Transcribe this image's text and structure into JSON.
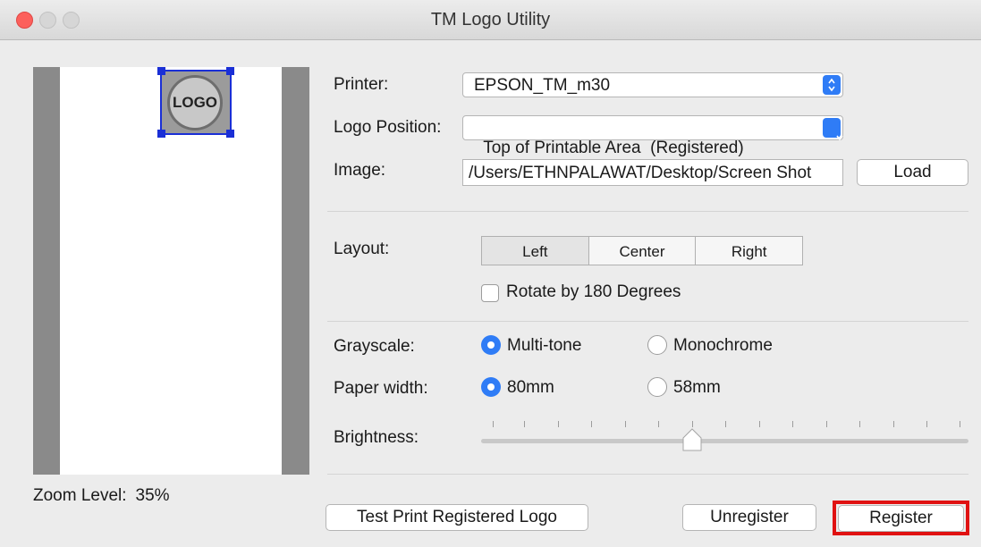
{
  "window": {
    "title": "TM Logo Utility"
  },
  "preview": {
    "logo_text": "LOGO",
    "zoom_label": "Zoom Level:",
    "zoom_value": "35%"
  },
  "printer": {
    "label": "Printer:",
    "value": "EPSON_TM_m30"
  },
  "logo_position": {
    "label": "Logo Position:",
    "value": "Top of Printable Area  (Registered)"
  },
  "image": {
    "label": "Image:",
    "path": "/Users/ETHNPALAWAT/Desktop/Screen Shot",
    "load_label": "Load"
  },
  "layout": {
    "label": "Layout:",
    "options": [
      "Left",
      "Center",
      "Right"
    ],
    "selected": "Left",
    "rotate_label": "Rotate by 180 Degrees",
    "rotate_checked": false
  },
  "grayscale": {
    "label": "Grayscale:",
    "options": [
      "Multi-tone",
      "Monochrome"
    ],
    "selected": "Multi-tone"
  },
  "paper_width": {
    "label": "Paper width:",
    "options": [
      "80mm",
      "58mm"
    ],
    "selected": "80mm"
  },
  "brightness": {
    "label": "Brightness:",
    "value_fraction": 0.43
  },
  "buttons": {
    "test_print": "Test Print Registered Logo",
    "unregister": "Unregister",
    "register": "Register"
  },
  "colors": {
    "accent": "#2f7cf6",
    "highlight": "#e01212",
    "selection": "#1a2fd6"
  },
  "icons": {
    "stepper": "updown-chevron-icon",
    "dropdown": "chevron-down-icon"
  }
}
